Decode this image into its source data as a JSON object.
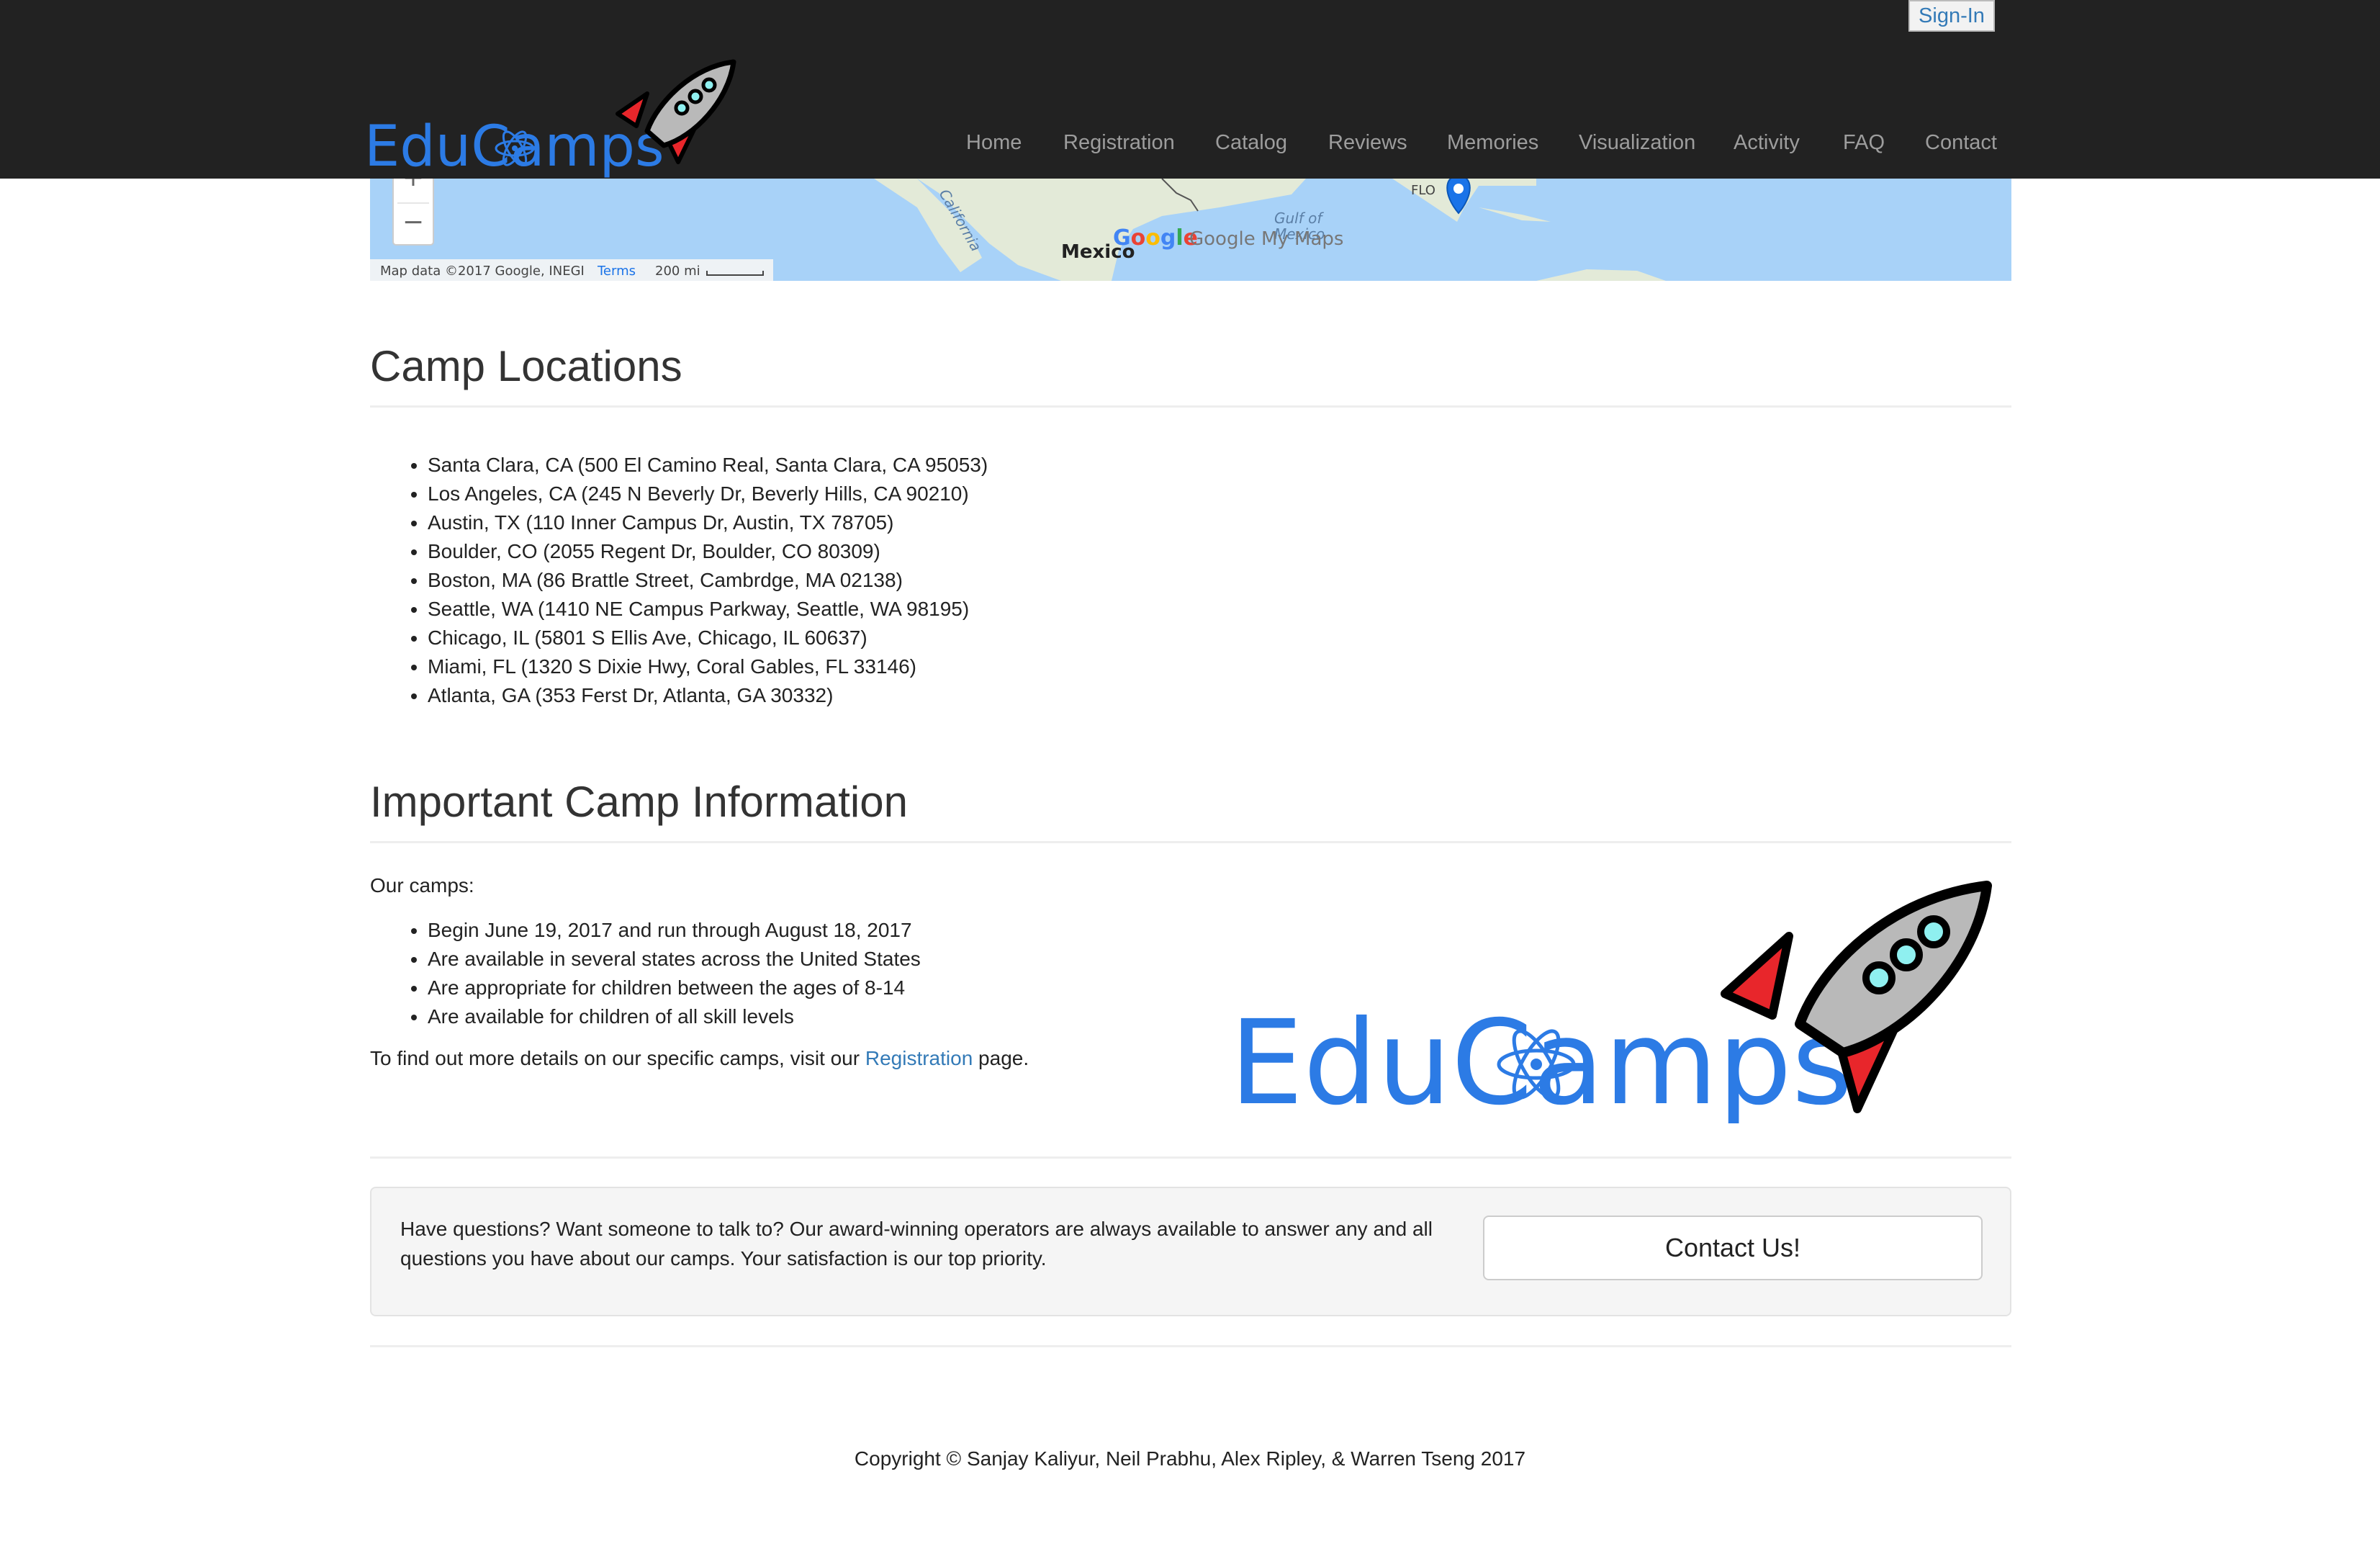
{
  "navbar": {
    "signin_label": "Sign-In",
    "brand": "EduCamps",
    "links": [
      "Home",
      "Registration",
      "Catalog",
      "Reviews",
      "Memories",
      "Visualization",
      "Activity",
      "FAQ",
      "Contact"
    ]
  },
  "map": {
    "zoom_in": "+",
    "zoom_out": "−",
    "labels": {
      "mexico": "Mexico",
      "gulf": "Gulf of",
      "gulf2": "Mexico",
      "california": "California",
      "florida": "FLO"
    },
    "branding": "Google My Maps",
    "attribution": "Map data ©2017 Google, INEGI",
    "terms": "Terms",
    "scale": "200 mi"
  },
  "locations": {
    "title": "Camp Locations",
    "items": [
      "Santa Clara, CA (500 El Camino Real, Santa Clara, CA 95053)",
      "Los Angeles, CA (245 N Beverly Dr, Beverly Hills, CA 90210)",
      "Austin, TX (110 Inner Campus Dr, Austin, TX 78705)",
      "Boulder, CO (2055 Regent Dr, Boulder, CO 80309)",
      "Boston, MA (86 Brattle Street, Cambrdge, MA 02138)",
      "Seattle, WA (1410 NE Campus Parkway, Seattle, WA 98195)",
      "Chicago, IL (5801 S Ellis Ave, Chicago, IL 60637)",
      "Miami, FL (1320 S Dixie Hwy, Coral Gables, FL 33146)",
      "Atlanta, GA (353 Ferst Dr, Atlanta, GA 30332)"
    ]
  },
  "info": {
    "title": "Important Camp Information",
    "intro": "Our camps:",
    "items": [
      "Begin June 19, 2017 and run through August 18, 2017",
      "Are available in several states across the United States",
      "Are appropriate for children between the ages of 8-14",
      "Are available for children of all skill levels"
    ],
    "details_prefix": "To find out more details on our specific camps, visit our ",
    "details_link": "Registration",
    "details_suffix": " page."
  },
  "logo_text": "EduCamps",
  "contact": {
    "text": "Have questions? Want someone to talk to? Our award-winning operators are always available to answer any and all questions you have about our camps. Your satisfaction is our top priority.",
    "button": "Contact Us!"
  },
  "footer": {
    "copyright": "Copyright © Sanjay Kaliyur, Neil Prabhu, Alex Ripley, & Warren Tseng 2017"
  },
  "colors": {
    "navbar_bg": "#222222",
    "nav_link": "#9d9d9d",
    "brand_blue": "#2c7be5",
    "link_blue": "#337ab7",
    "rocket_red": "#e8262b",
    "rocket_gray": "#b9b9b9",
    "window_cyan": "#8ff0f0"
  }
}
